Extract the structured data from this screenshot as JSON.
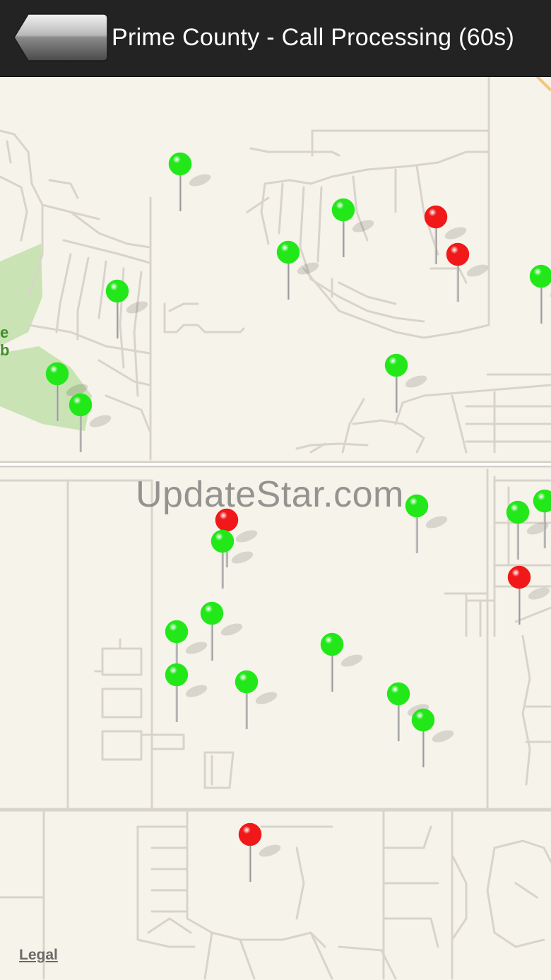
{
  "navbar": {
    "title": "Prime County - Call Processing (60s)",
    "back_icon": "back-arrow-icon"
  },
  "map": {
    "watermark": "UpdateStar.com",
    "park_label_line1": "e",
    "park_label_line2": "b",
    "legal_label": "Legal",
    "colors": {
      "background": "#f6f3ea",
      "road": "#d8d4cb",
      "park": "#c9e3b4",
      "pin_green": "#22e81a",
      "pin_red": "#f01818"
    },
    "pins": [
      {
        "id": "pin-1",
        "status": "green"
      },
      {
        "id": "pin-2",
        "status": "green"
      },
      {
        "id": "pin-3",
        "status": "red"
      },
      {
        "id": "pin-4",
        "status": "red"
      },
      {
        "id": "pin-5",
        "status": "green"
      },
      {
        "id": "pin-6",
        "status": "green"
      },
      {
        "id": "pin-7",
        "status": "green"
      },
      {
        "id": "pin-8",
        "status": "green"
      },
      {
        "id": "pin-9",
        "status": "green"
      },
      {
        "id": "pin-10",
        "status": "green"
      },
      {
        "id": "pin-11",
        "status": "green"
      },
      {
        "id": "pin-12",
        "status": "red"
      },
      {
        "id": "pin-13",
        "status": "green"
      },
      {
        "id": "pin-14",
        "status": "green"
      },
      {
        "id": "pin-15",
        "status": "green"
      },
      {
        "id": "pin-16",
        "status": "red"
      },
      {
        "id": "pin-17",
        "status": "green"
      },
      {
        "id": "pin-18",
        "status": "green"
      },
      {
        "id": "pin-19",
        "status": "green"
      },
      {
        "id": "pin-20",
        "status": "green"
      },
      {
        "id": "pin-21",
        "status": "green"
      },
      {
        "id": "pin-22",
        "status": "green"
      },
      {
        "id": "pin-23",
        "status": "green"
      },
      {
        "id": "pin-24",
        "status": "green"
      },
      {
        "id": "pin-25",
        "status": "red"
      }
    ]
  }
}
